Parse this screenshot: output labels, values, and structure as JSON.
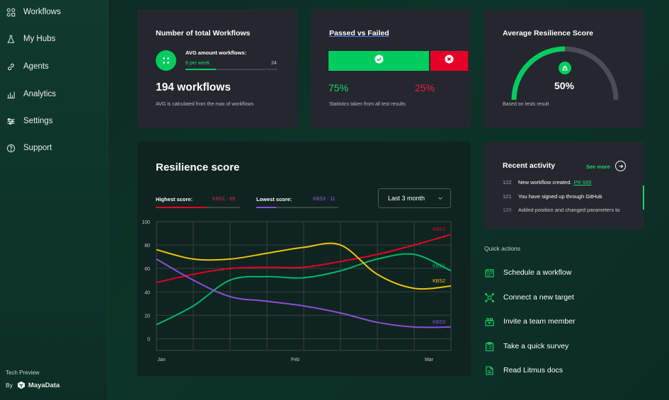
{
  "sidebar": {
    "items": [
      {
        "label": "Workflows",
        "icon": "workflows-icon"
      },
      {
        "label": "My Hubs",
        "icon": "flask-icon"
      },
      {
        "label": "Agents",
        "icon": "link-icon"
      },
      {
        "label": "Analytics",
        "icon": "bar-chart-icon"
      },
      {
        "label": "Settings",
        "icon": "sliders-icon"
      },
      {
        "label": "Support",
        "icon": "help-circle-icon"
      }
    ],
    "tech_preview": "Tech Preview",
    "by": "By",
    "brand": "MayaData"
  },
  "workflows_card": {
    "title": "Number of total Workflows",
    "avg_label": "AVG amount workflows:",
    "per_week": "8 per week",
    "max_count": "24",
    "progress": 0.33,
    "total": "194 workflows",
    "note": "AVG is calculated from the max of workflows"
  },
  "pass_fail_card": {
    "title": "Passed vs Failed",
    "passed_pct": "75%",
    "failed_pct": "25%",
    "passed_value": 75,
    "failed_value": 25,
    "note": "Statistics taken from all test results"
  },
  "resilience_card": {
    "title": "Average Resilience Score",
    "score": "50%",
    "score_value": 50,
    "note": "Based on tests result"
  },
  "chart_card": {
    "title": "Resilience score",
    "highest_label": "Highest score:",
    "highest_value": "KBS1 - 89",
    "lowest_label": "Lowest score:",
    "lowest_value": "KBS3 - 11",
    "range_select": "Last 3 month"
  },
  "chart_data": {
    "type": "line",
    "title": "Resilience score",
    "xlabel": "",
    "ylabel": "",
    "x_ticks": [
      "Jan",
      "Feb",
      "Mar"
    ],
    "y_ticks": [
      0,
      20,
      40,
      60,
      80,
      100
    ],
    "ylim": [
      -10,
      100
    ],
    "grid": true,
    "x": [
      0,
      1,
      2,
      3,
      4,
      5,
      6,
      7,
      8
    ],
    "series": [
      {
        "name": "KBS3",
        "color": "#e60026",
        "values": [
          48,
          55,
          60,
          61,
          61,
          66,
          72,
          80,
          89
        ],
        "end_label": "KBS3"
      },
      {
        "name": "KBS1",
        "color": "#00b66b",
        "values": [
          12,
          28,
          50,
          53,
          52,
          58,
          68,
          72,
          58
        ],
        "end_label": "KBS1"
      },
      {
        "name": "KBS2",
        "color": "#f0c20c",
        "values": [
          76,
          68,
          68,
          73,
          78,
          80,
          55,
          43,
          45
        ],
        "end_label": "KBS2"
      },
      {
        "name": "KBS3",
        "color": "#8f4dd8",
        "values": [
          68,
          50,
          36,
          32,
          28,
          22,
          14,
          10,
          10
        ],
        "end_label": "KBS3"
      }
    ]
  },
  "recent_activity": {
    "title": "Recent activity",
    "see_more": "See more",
    "items": [
      {
        "num": "122",
        "text": "New workflow created.",
        "link": "PR 689"
      },
      {
        "num": "121",
        "text": "You have signed up through GitHub"
      },
      {
        "num": "120",
        "text": "Added position and changed parameters to"
      }
    ]
  },
  "quick_actions": {
    "title": "Quick actions",
    "items": [
      {
        "label": "Schedule a workflow",
        "icon": "calendar-icon"
      },
      {
        "label": "Connect a new target",
        "icon": "target-icon"
      },
      {
        "label": "Invite a team member",
        "icon": "team-icon"
      },
      {
        "label": "Take a quick survey",
        "icon": "survey-icon"
      },
      {
        "label": "Read Litmus docs",
        "icon": "docs-icon"
      }
    ]
  },
  "colors": {
    "accent_green": "#00cc5e",
    "fail_red": "#e60026",
    "card_bg": "#25272f",
    "chart_bg": "#0f2420"
  }
}
